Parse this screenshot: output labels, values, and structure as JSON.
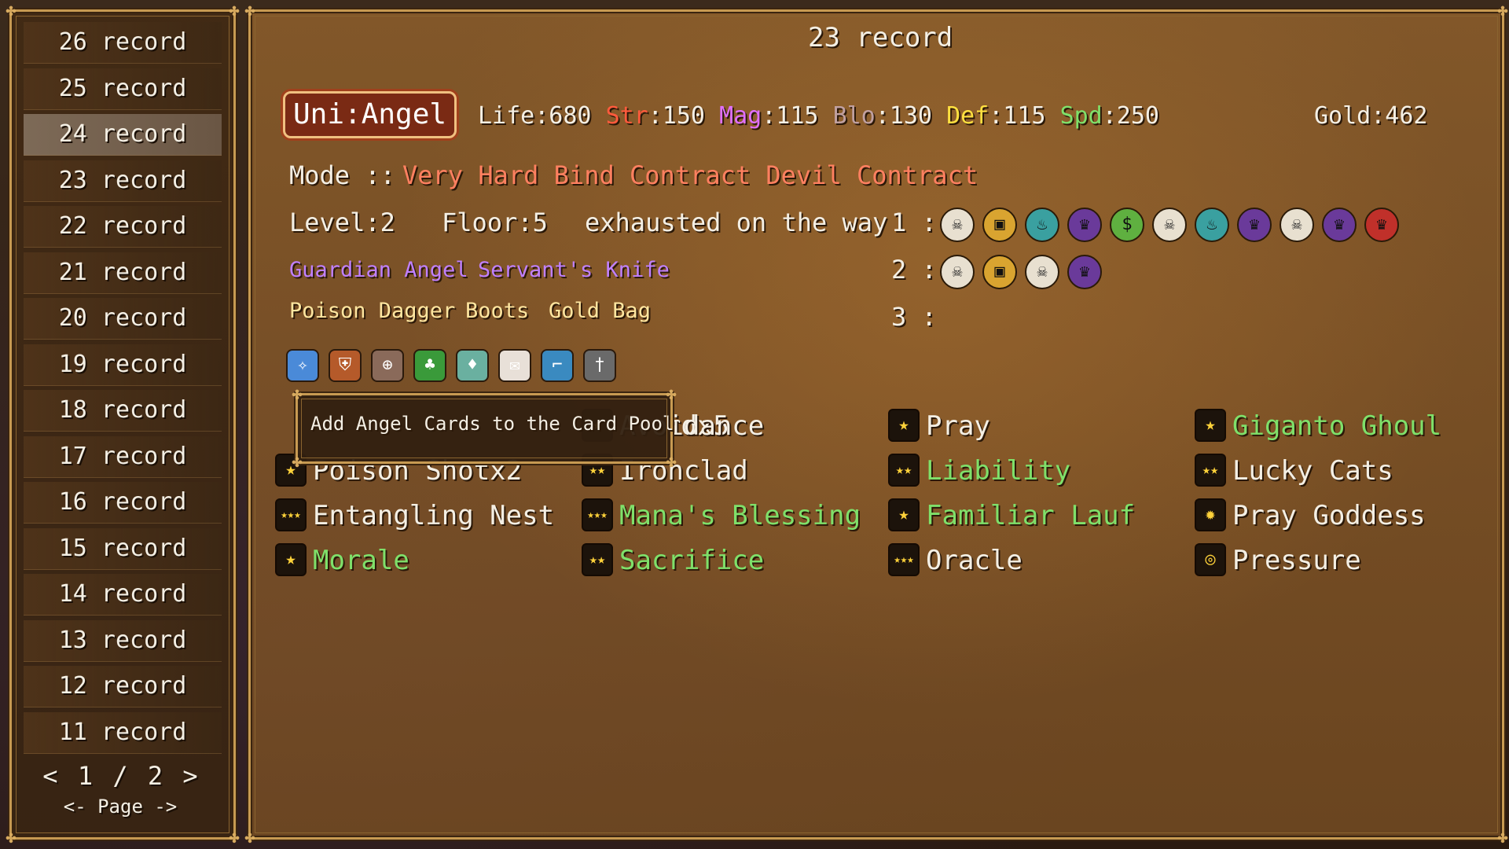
{
  "left_panel": {
    "records": [
      "26 record",
      "25 record",
      "24 record",
      "23 record",
      "22 record",
      "21 record",
      "20 record",
      "19 record",
      "18 record",
      "17 record",
      "16 record",
      "15 record",
      "14 record",
      "13 record",
      "12 record",
      "11 record"
    ],
    "selected_index": 2,
    "pager": {
      "prev": "<",
      "page": "1 / 2",
      "next": ">",
      "label": "<- Page ->"
    }
  },
  "detail": {
    "title": "23 record",
    "character": "Uni:Angel",
    "stats": {
      "life": "Life:680",
      "str_label": "Str",
      "str_value": ":150",
      "mag_label": "Mag",
      "mag_value": ":115",
      "blo_label": "Blo",
      "blo_value": ":130",
      "def_label": "Def",
      "def_value": ":115",
      "spd_label": "Spd",
      "spd_value": ":250",
      "gold": "Gold:462"
    },
    "mode_label": "Mode ::",
    "mode_value": "Very Hard Bind Contract Devil Contract",
    "level": "Level:2",
    "floor": "Floor:5",
    "result": "exhausted on the way",
    "row_labels": [
      "1 :",
      "2 :",
      "3 :"
    ],
    "relics_row1": [
      "skull",
      "chest",
      "flame",
      "demon",
      "sack",
      "skull",
      "flame",
      "demon",
      "skull",
      "demon",
      "red-demon"
    ],
    "relics_row2": [
      "skull",
      "chest",
      "skull",
      "demon"
    ],
    "blessings": [
      "Guardian Angel",
      "Servant's Knife"
    ],
    "equipment": [
      "Poison Dagger",
      "Boots",
      "Gold Bag"
    ],
    "item_icons": [
      "wings",
      "shield",
      "compass",
      "leaf",
      "potion",
      "letter",
      "boot",
      "knife"
    ],
    "tooltip": "Add Angel Cards to the Card Pool",
    "cards": [
      {
        "name": "rdx5",
        "color": "#f4efe4",
        "rank": "",
        "partial": true
      },
      {
        "name": "Avoidance",
        "color": "#f4efe4",
        "rank": "★"
      },
      {
        "name": "Pray",
        "color": "#f4efe4",
        "rank": "★"
      },
      {
        "name": "Giganto Ghoul",
        "color": "#7fe06a",
        "rank": "★"
      },
      {
        "name": "Poison Shotx2",
        "color": "#f4efe4",
        "rank": "★"
      },
      {
        "name": "Ironclad",
        "color": "#f4efe4",
        "rank": "★★"
      },
      {
        "name": "Liability",
        "color": "#7fe06a",
        "rank": "★★"
      },
      {
        "name": "Lucky Cats",
        "color": "#f4efe4",
        "rank": "★★"
      },
      {
        "name": "Entangling Nest",
        "color": "#f4efe4",
        "rank": "★★★"
      },
      {
        "name": "Mana's Blessing",
        "color": "#7fe06a",
        "rank": "★★★"
      },
      {
        "name": "Familiar Lauf",
        "color": "#7fe06a",
        "rank": "★"
      },
      {
        "name": "Pray Goddess",
        "color": "#f4efe4",
        "rank": "✹"
      },
      {
        "name": "Morale",
        "color": "#7fe06a",
        "rank": "★"
      },
      {
        "name": "Sacrifice",
        "color": "#7fe06a",
        "rank": "★★"
      },
      {
        "name": "Oracle",
        "color": "#f4efe4",
        "rank": "★★★"
      },
      {
        "name": "Pressure",
        "color": "#f4efe4",
        "rank": "◎"
      }
    ]
  },
  "colors": {
    "str": "#ff5a3c",
    "mag": "#e070ff",
    "blo": "#c0a0a0",
    "def": "#ffe040",
    "spd": "#7fe06a",
    "mode": "#ff8060",
    "blessing": "#c080ff",
    "equipment": "#ffe6a0"
  }
}
